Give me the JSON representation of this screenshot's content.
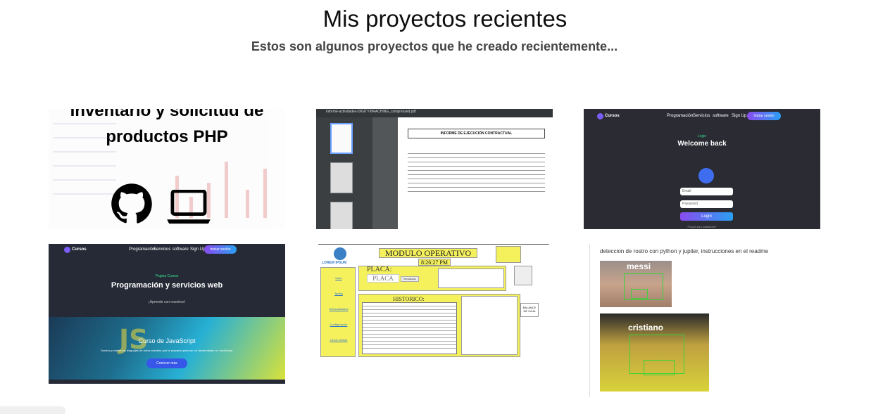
{
  "header": {
    "title": "Mis proyectos recientes",
    "subtitle": "Estos son algunos proyectos que he creado recientemente..."
  },
  "projects": [
    {
      "id": "inventario",
      "title": "Inventario y solicitud de productos PHP",
      "icons": [
        "github-icon",
        "laptop-icon"
      ]
    },
    {
      "id": "informe",
      "pdf_file": "informe-actividades-DIGITY-BRACHING_compressed.pdf",
      "pdf_heading": "INFORME DE EJECUCIÓN CONTRACTUAL"
    },
    {
      "id": "login",
      "brand": "Cursos",
      "nav": [
        "Programación",
        "Servicios",
        "software",
        "Sign Up"
      ],
      "nav_button": "Iniciar sesión",
      "small": "Login",
      "heading": "Welcome back",
      "email_placeholder": "Email",
      "password_placeholder": "Password",
      "button": "Login",
      "forgot": "Forgot your password?"
    },
    {
      "id": "cursos",
      "brand": "Cursos",
      "nav": [
        "Programación",
        "Servicios",
        "software",
        "Sign Up"
      ],
      "nav_button": "Iniciar sesión",
      "small": "Pagina Cursos",
      "heading": "Programación y servicios web",
      "sub": "¡Aprende con nosotros!",
      "banner_title": "Curso de JavaScript",
      "banner_desc": "Domina y vuelve los lenguajes de todos actuales que te preparan para ser un desarrollador en JavaScript.",
      "banner_button": "Conocer más"
    },
    {
      "id": "modulo",
      "logo": "LOREM IPSUM",
      "title": "MODULO OPERATIVO",
      "time": "8:26:27 PM",
      "placa_label": "PLACA:",
      "placa_input": "PLACA",
      "placa_button": "PROGRAMA",
      "links": [
        "Inicio",
        "Tarifas",
        "Mensualidades",
        "Configuración",
        "Cerrar Sesión"
      ],
      "historico": "HISTORICO:",
      "balance": "BALANCE DE CAJA"
    },
    {
      "id": "rostro",
      "caption": "deteccion de rostro con python y jupiter, instrucciones en el readme",
      "label1": "messi",
      "label2": "cristiano"
    }
  ],
  "colors": {
    "accent_gradient_start": "#8a4bf0",
    "accent_gradient_end": "#2aa0f3",
    "dark_bg": "#2a2b33",
    "detect_box": "#38d33a",
    "yellow_panel": "#f5f15d"
  }
}
